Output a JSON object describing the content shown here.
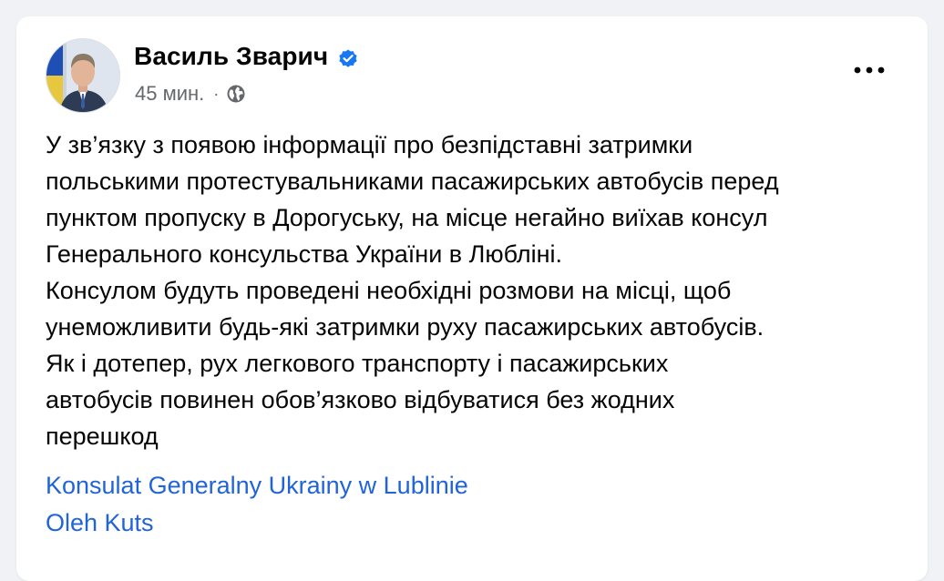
{
  "post": {
    "author": "Василь Зварич",
    "verified_icon": "verified-badge-icon",
    "time": "45 мин.",
    "separator": "·",
    "audience_icon": "globe-icon",
    "more_icon": "more-options-icon",
    "text": "У зв’язку з появою інформації про безпідставні затримки\nпольськими протестувальниками пасажирських автобусів перед\nпунктом пропуску в Дорогуську, на місце негайно виїхав консул\nГенерального консульства України в Любліні.\nКонсулом будуть проведені необхідні розмови на місці, щоб\nунеможливити будь-які затримки руху пасажирських автобусів.\nЯк і дотепер, рух легкового транспорту і пасажирських\nавтобусів повинен обов’язково відбуватися без жодних\nперешкод",
    "tags": [
      "Konsulat Generalny Ukrainy w Lublinie",
      "Oleh Kuts"
    ]
  },
  "colors": {
    "background": "#f0f2f5",
    "card": "#ffffff",
    "text": "#050505",
    "secondary_text": "#65676b",
    "link": "#2064d8",
    "verified": "#1877f2"
  }
}
